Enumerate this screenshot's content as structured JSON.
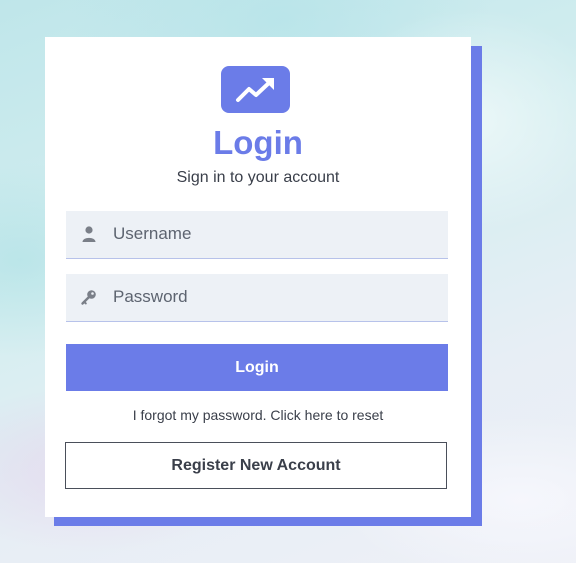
{
  "login_card": {
    "logo_icon": "trending-up-icon",
    "title": "Login",
    "subtitle": "Sign in to your account",
    "username": {
      "icon": "user-icon",
      "placeholder": "Username",
      "value": ""
    },
    "password": {
      "icon": "key-icon",
      "placeholder": "Password",
      "value": ""
    },
    "login_button_label": "Login",
    "forgot_link": "I forgot my password. Click here to reset",
    "register_button_label": "Register New Account"
  },
  "colors": {
    "accent": "#6b7ce8",
    "field_background": "#edf1f6",
    "text": "#3a3f4a"
  }
}
